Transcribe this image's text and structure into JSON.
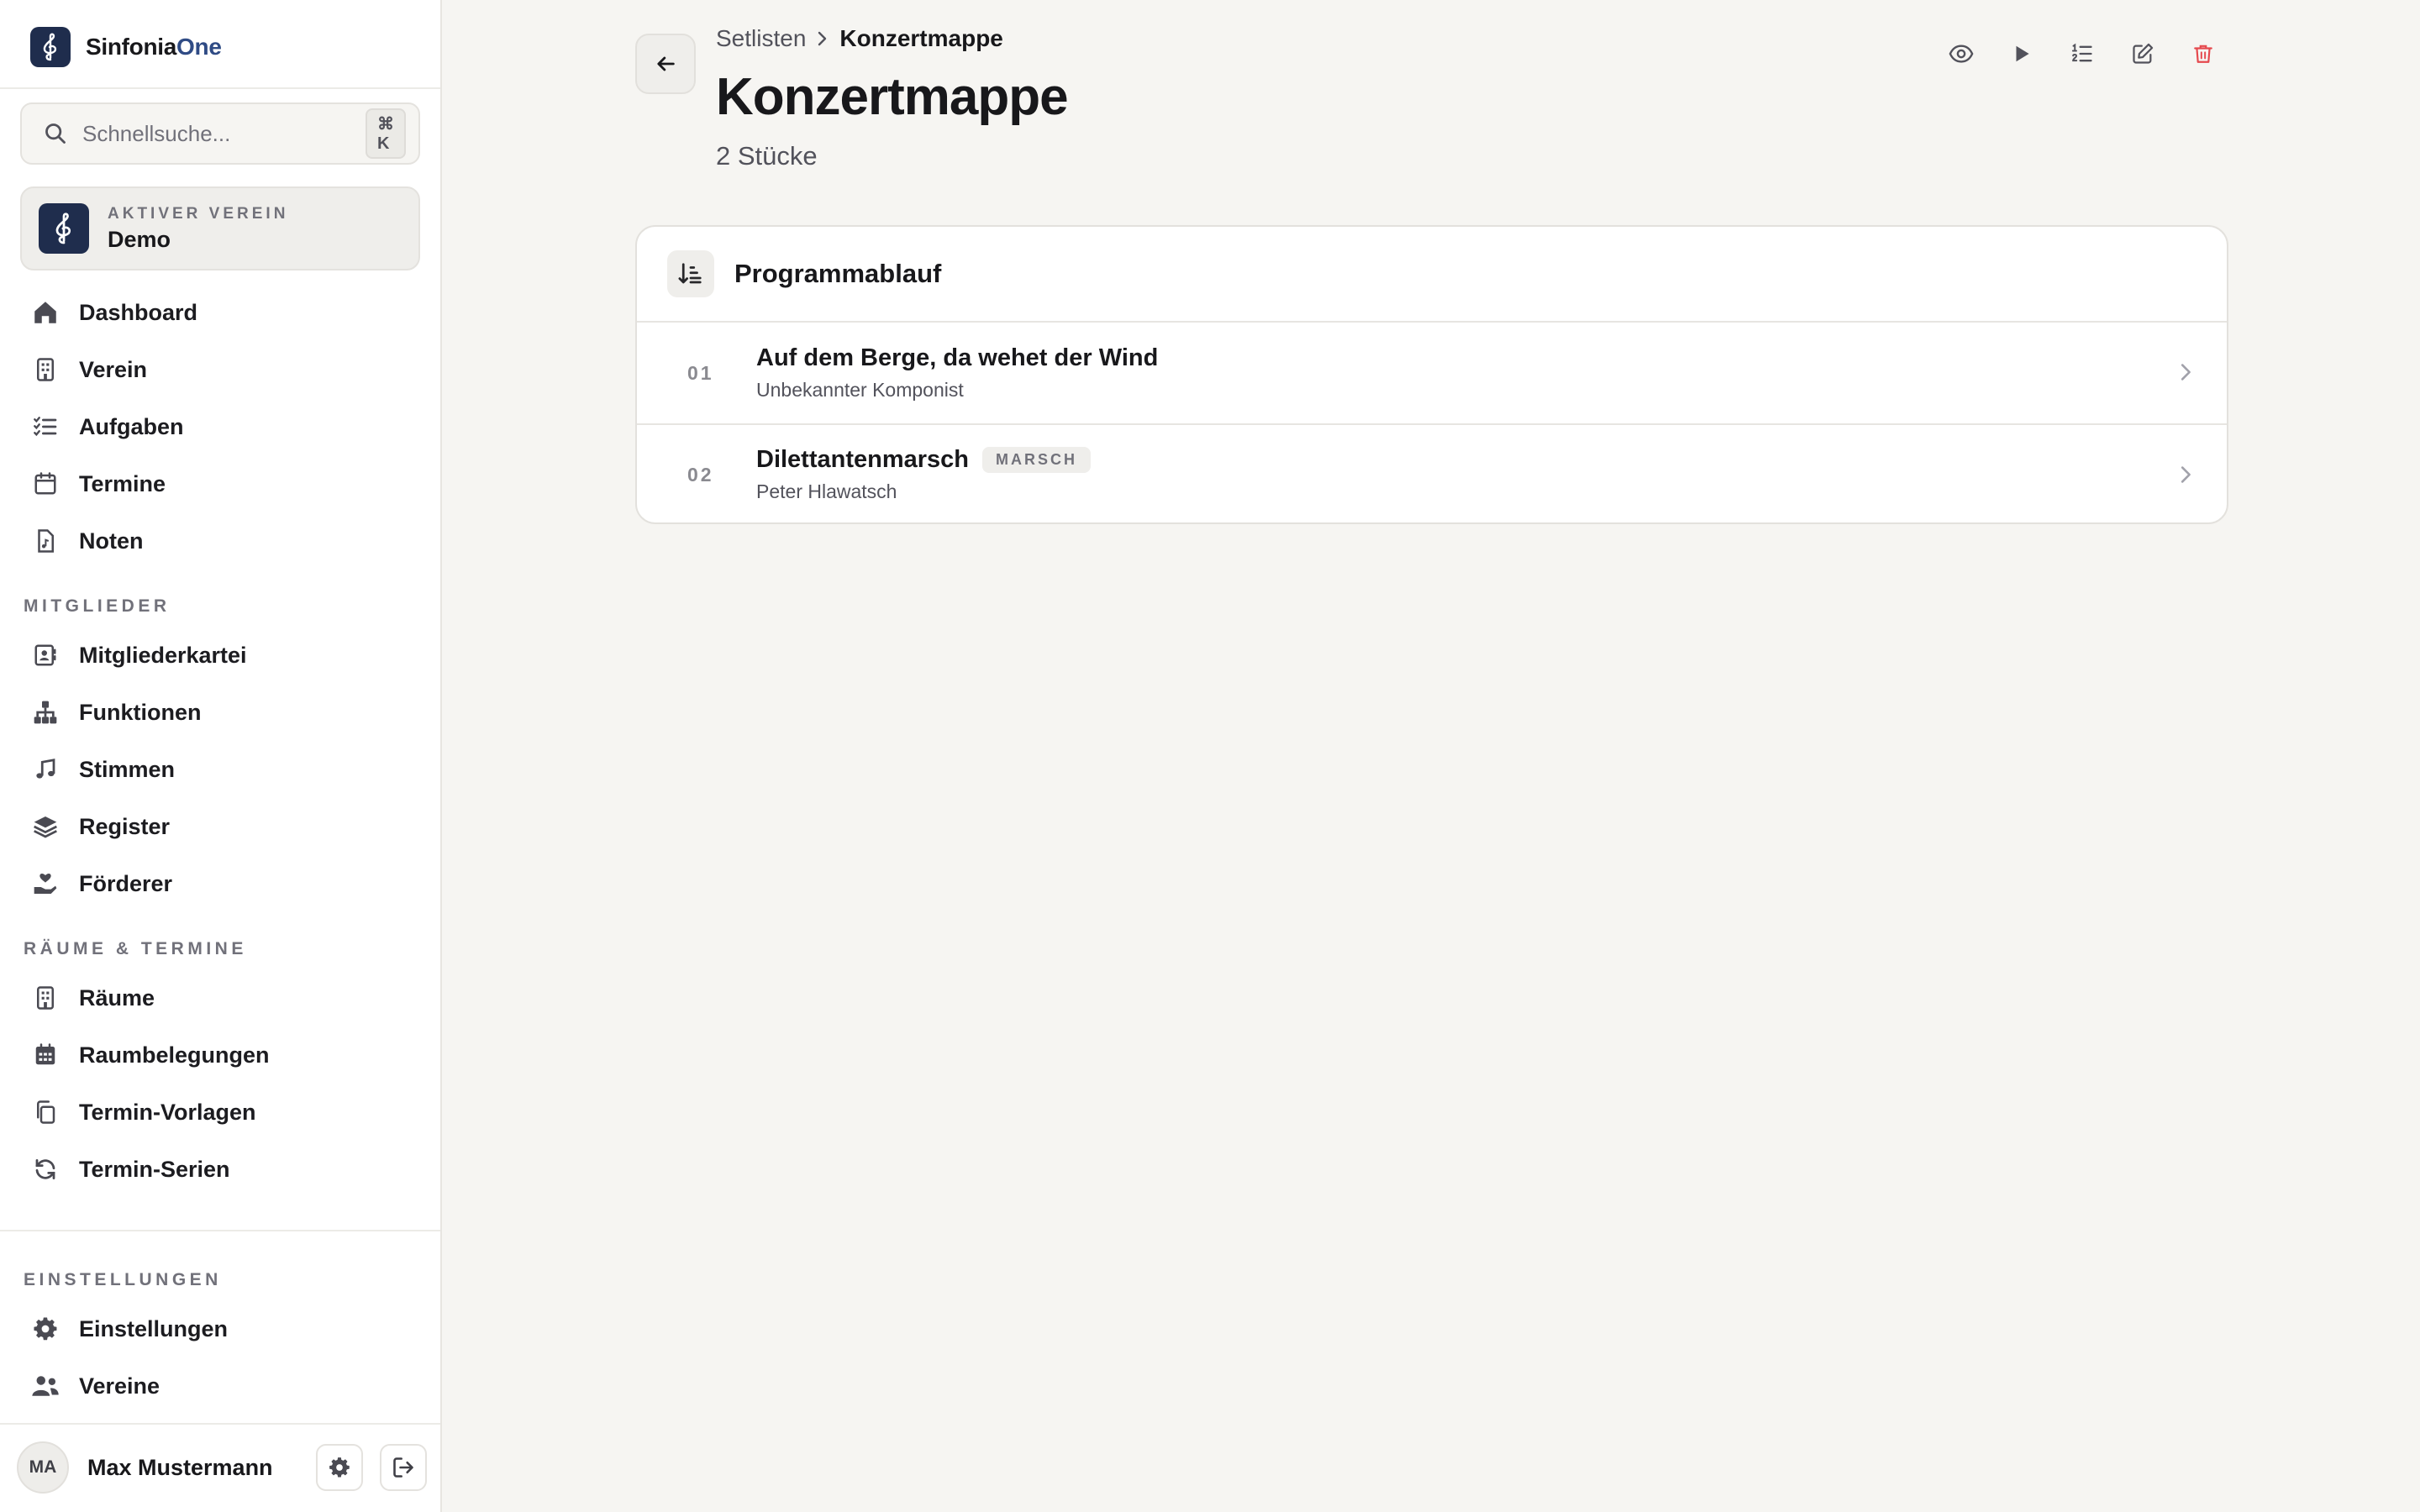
{
  "app": {
    "brand_primary": "Sinfonia",
    "brand_accent": "One",
    "accent_color": "#2f4b85",
    "logo_bg": "#1f2d4d"
  },
  "search": {
    "placeholder": "Schnellsuche...",
    "shortcut": "⌘ K"
  },
  "club": {
    "kicker": "Aktiver Verein",
    "name": "Demo"
  },
  "sidebar": {
    "main_items": [
      {
        "label": "Dashboard",
        "icon": "home-icon"
      },
      {
        "label": "Verein",
        "icon": "building-icon"
      },
      {
        "label": "Aufgaben",
        "icon": "checklist-icon"
      },
      {
        "label": "Termine",
        "icon": "calendar-icon"
      },
      {
        "label": "Noten",
        "icon": "sheet-music-icon"
      }
    ],
    "section_members": "Mitglieder",
    "member_items": [
      {
        "label": "Mitgliederkartei",
        "icon": "contact-card-icon"
      },
      {
        "label": "Funktionen",
        "icon": "hierarchy-icon"
      },
      {
        "label": "Stimmen",
        "icon": "music-note-icon"
      },
      {
        "label": "Register",
        "icon": "layers-icon"
      },
      {
        "label": "Förderer",
        "icon": "hand-heart-icon"
      }
    ],
    "section_rooms": "Räume & Termine",
    "room_items": [
      {
        "label": "Räume",
        "icon": "building-icon"
      },
      {
        "label": "Raumbelegungen",
        "icon": "calendar-grid-icon"
      },
      {
        "label": "Termin-Vorlagen",
        "icon": "copy-icon"
      },
      {
        "label": "Termin-Serien",
        "icon": "refresh-icon"
      }
    ],
    "section_settings": "Einstellungen",
    "settings_items": [
      {
        "label": "Einstellungen",
        "icon": "gear-icon"
      },
      {
        "label": "Vereine",
        "icon": "users-icon"
      }
    ]
  },
  "user": {
    "initials": "MA",
    "name": "Max Mustermann"
  },
  "breadcrumb": {
    "parent": "Setlisten",
    "current": "Konzertmappe"
  },
  "page": {
    "title": "Konzertmappe",
    "subtitle": "2 Stücke"
  },
  "toolbar": {
    "danger_color": "#e5484d"
  },
  "program": {
    "title": "Programmablauf",
    "pieces": [
      {
        "number": "01",
        "title": "Auf dem Berge, da wehet der Wind",
        "composer": "Unbekannter Komponist",
        "tag": ""
      },
      {
        "number": "02",
        "title": "Dilettantenmarsch",
        "composer": "Peter Hlawatsch",
        "tag": "MARSCH"
      }
    ]
  }
}
